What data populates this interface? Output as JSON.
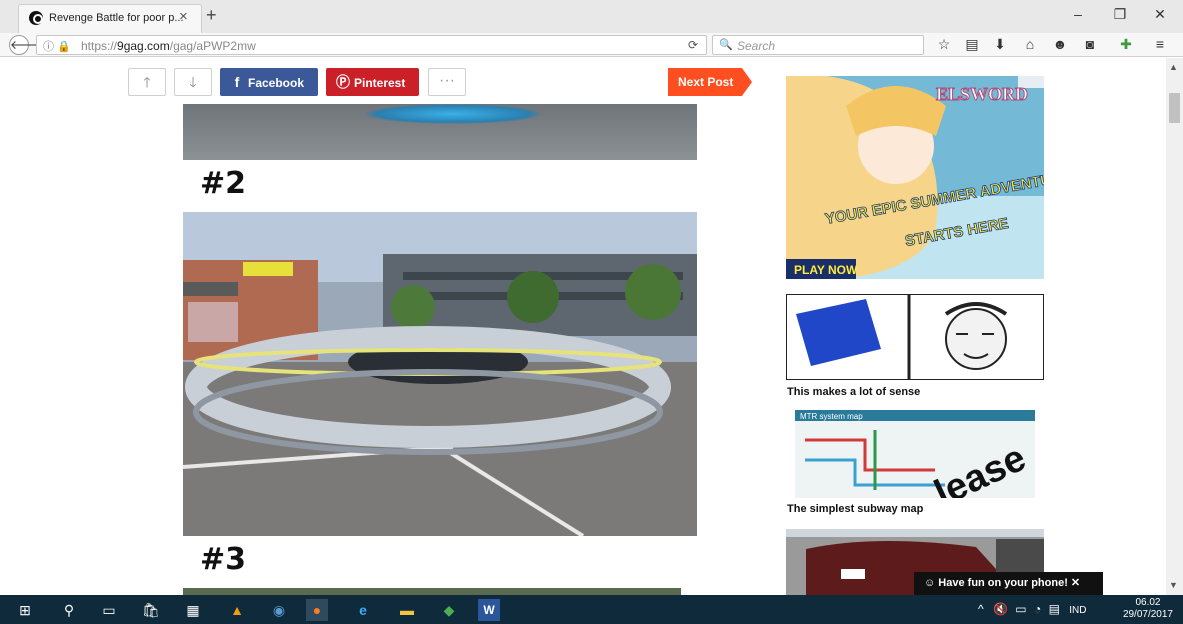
{
  "browser": {
    "tab_title": "Revenge Battle for poor p...",
    "url_prefix": "https://",
    "url_domain": "9gag.com",
    "url_path": "/gag/aPWP2mw",
    "search_placeholder": "Search"
  },
  "post": {
    "share_facebook": "Facebook",
    "share_pinterest": "Pinterest",
    "more": "···",
    "next_post": "Next Post",
    "label_2": "#2",
    "label_3": "#3"
  },
  "sidebar": {
    "ad_title": "ELSWORD",
    "ad_slogan_1": "YOUR EPIC SUMMER ADVENTURE",
    "ad_slogan_2": "STARTS HERE",
    "ad_cta": "PLAY NOW",
    "items": [
      {
        "caption": "This makes a lot of sense"
      },
      {
        "caption": "The simplest subway map",
        "map_title": "MTR system map",
        "overlay": "lease"
      }
    ]
  },
  "toast": {
    "text": "Have fun on your phone!",
    "close": "✕"
  },
  "taskbar": {
    "lang": "IND",
    "time": "06.02",
    "date": "29/07/2017"
  },
  "colors": {
    "facebook": "#3b5998",
    "pinterest": "#cb2027",
    "next_post": "#ff4e1f",
    "taskbar": "#0f2a3a"
  }
}
